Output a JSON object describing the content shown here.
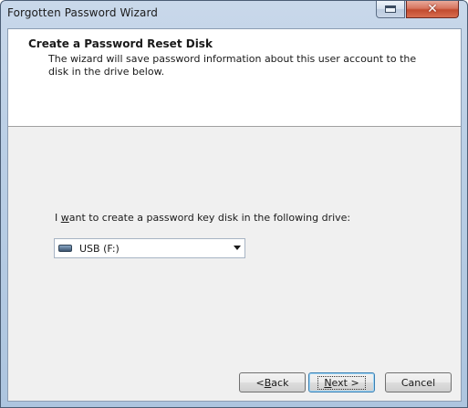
{
  "window": {
    "title": "Forgotten Password Wizard"
  },
  "header": {
    "title": "Create a Password Reset Disk",
    "description": "The wizard will save password information about this user account to the disk in the drive below."
  },
  "main": {
    "prompt_pre": "I ",
    "prompt_accel": "w",
    "prompt_post": "ant to create a password key disk in the following drive:",
    "drive_select": {
      "selected": "USB (F:)",
      "icon": "usb-drive-icon"
    }
  },
  "footer": {
    "back": {
      "pre": "< ",
      "accel": "B",
      "post": "ack"
    },
    "next": {
      "accel": "N",
      "post": "ext >"
    },
    "cancel": "Cancel"
  }
}
